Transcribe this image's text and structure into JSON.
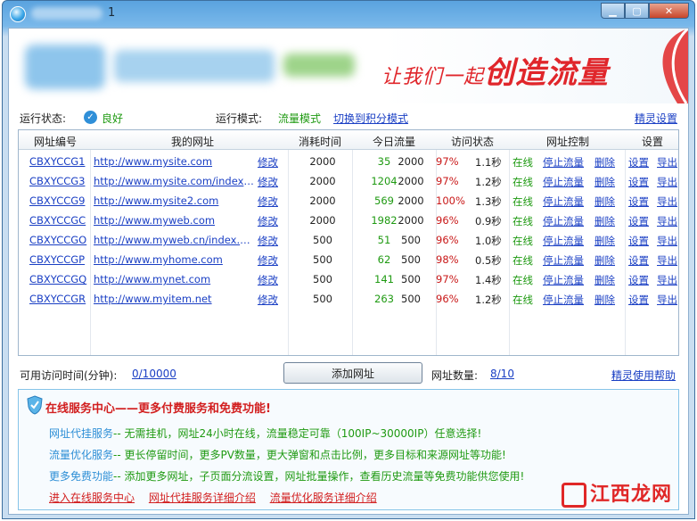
{
  "window": {
    "title": "1"
  },
  "banner": {
    "slogan_small": "让我们一起",
    "slogan_big": "创造流量"
  },
  "status": {
    "run_state_label": "运行状态:",
    "run_state_value": "良好",
    "mode_label": "运行模式:",
    "mode_value": "流量模式",
    "switch_link": "切换到积分模式",
    "settings_link": "精灵设置"
  },
  "table": {
    "headers": [
      "网址编号",
      "我的网址",
      "消耗时间",
      "今日流量",
      "访问状态",
      "网址控制",
      "设置"
    ],
    "rows": [
      {
        "id": "CBXYCCG1",
        "url": "http://www.mysite.com",
        "edit": "修改",
        "cost": "2000",
        "today": "35",
        "limit": "2000",
        "pct": "97%",
        "time": "1.1秒",
        "online": "在线",
        "stop": "停止流量",
        "del": "删除",
        "set": "设置",
        "exp": "导出"
      },
      {
        "id": "CBXYCCG3",
        "url": "http://www.mysite.com/index....",
        "edit": "修改",
        "cost": "2000",
        "today": "1204",
        "limit": "2000",
        "pct": "97%",
        "time": "1.2秒",
        "online": "在线",
        "stop": "停止流量",
        "del": "删除",
        "set": "设置",
        "exp": "导出"
      },
      {
        "id": "CBXYCCG9",
        "url": "http://www.mysite2.com",
        "edit": "修改",
        "cost": "2000",
        "today": "569",
        "limit": "2000",
        "pct": "100%",
        "time": "1.3秒",
        "online": "在线",
        "stop": "停止流量",
        "del": "删除",
        "set": "设置",
        "exp": "导出"
      },
      {
        "id": "CBXYCCGC",
        "url": "http://www.myweb.com",
        "edit": "修改",
        "cost": "2000",
        "today": "1982",
        "limit": "2000",
        "pct": "96%",
        "time": "0.9秒",
        "online": "在线",
        "stop": "停止流量",
        "del": "删除",
        "set": "设置",
        "exp": "导出"
      },
      {
        "id": "CBXYCCGO",
        "url": "http://www.myweb.cn/index.htm",
        "edit": "修改",
        "cost": "500",
        "today": "51",
        "limit": "500",
        "pct": "96%",
        "time": "1.0秒",
        "online": "在线",
        "stop": "停止流量",
        "del": "删除",
        "set": "设置",
        "exp": "导出"
      },
      {
        "id": "CBXYCCGP",
        "url": "http://www.myhome.com",
        "edit": "修改",
        "cost": "500",
        "today": "62",
        "limit": "500",
        "pct": "98%",
        "time": "0.5秒",
        "online": "在线",
        "stop": "停止流量",
        "del": "删除",
        "set": "设置",
        "exp": "导出"
      },
      {
        "id": "CBXYCCGQ",
        "url": "http://www.mynet.com",
        "edit": "修改",
        "cost": "500",
        "today": "141",
        "limit": "500",
        "pct": "97%",
        "time": "1.4秒",
        "online": "在线",
        "stop": "停止流量",
        "del": "删除",
        "set": "设置",
        "exp": "导出"
      },
      {
        "id": "CBXYCCGR",
        "url": "http://www.myitem.net",
        "edit": "修改",
        "cost": "500",
        "today": "263",
        "limit": "500",
        "pct": "96%",
        "time": "1.2秒",
        "online": "在线",
        "stop": "停止流量",
        "del": "删除",
        "set": "设置",
        "exp": "导出"
      }
    ]
  },
  "bottom": {
    "time_label": "可用访问时间(分钟):",
    "time_value": "0/10000",
    "add_button": "添加网址",
    "count_label": "网址数量:",
    "count_value": "8/10",
    "help_link": "精灵使用帮助"
  },
  "service": {
    "title": "在线服务中心——更多付费服务和免费功能!",
    "lines": [
      {
        "key": "网址代挂服务",
        "value": "-- 无需挂机，网址24小时在线，流量稳定可靠（100IP~30000IP）任意选择!"
      },
      {
        "key": "流量优化服务",
        "value": "-- 更长停留时间，更多PV数量，更大弹窗和点击比例，更多目标和来源网址等功能!"
      },
      {
        "key": "更多免费功能",
        "value": "-- 添加更多网址，子页面分流设置，网址批量操作，查看历史流量等免费功能供您使用!"
      }
    ],
    "links": [
      "进入在线服务中心",
      "网址代挂服务详细介绍",
      "流量优化服务详细介绍"
    ]
  },
  "watermark": {
    "text": "江西龙网"
  },
  "colors": {
    "accent_blue": "#1a3fc4",
    "green": "#1f9a12",
    "red": "#d21f1f"
  }
}
